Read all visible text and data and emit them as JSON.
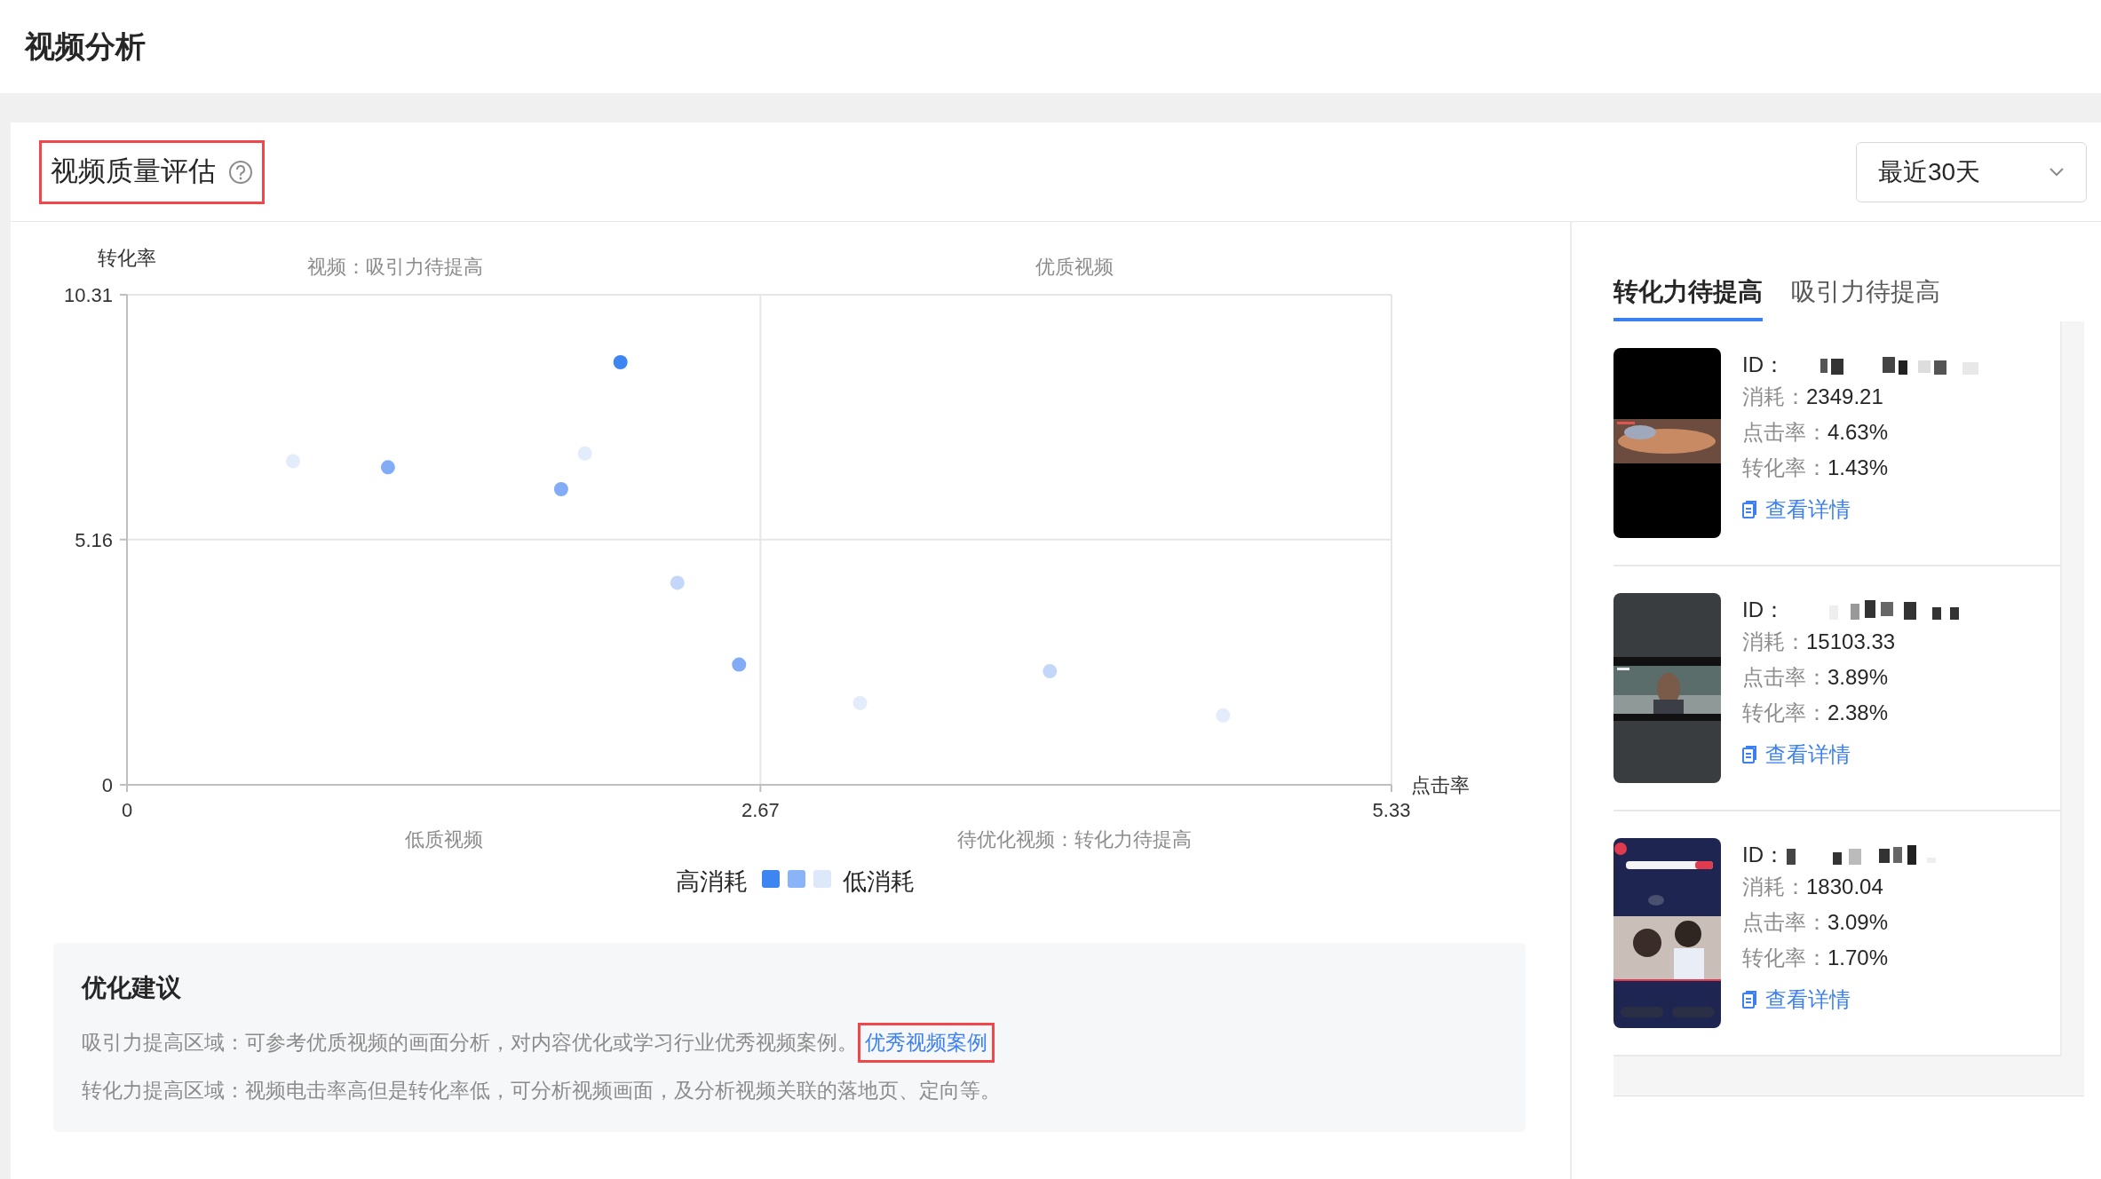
{
  "page_title": "视频分析",
  "card": {
    "title": "视频质量评估",
    "date_range": "最近30天"
  },
  "chart": {
    "quadrant_labels": {
      "top_left": "视频：吸引力待提高",
      "top_right": "优质视频",
      "bottom_left": "低质视频",
      "bottom_right": "待优化视频：转化力待提高"
    },
    "legend": {
      "high_label": "高消耗",
      "low_label": "低消耗",
      "swatches": [
        {
          "color": "#3d85f0"
        },
        {
          "color": "#8ab4f8"
        },
        {
          "color": "#dde8fb"
        }
      ]
    },
    "chart_data": {
      "type": "scatter",
      "xlabel": "点击率",
      "ylabel": "转化率",
      "xlim": [
        0,
        5.33
      ],
      "ylim": [
        0,
        10.31
      ],
      "xticks": [
        0,
        2.67,
        5.33
      ],
      "yticks": [
        0,
        5.16,
        10.31
      ],
      "series": [
        {
          "color": "#3d85f0",
          "x": [
            2.08
          ],
          "values": [
            8.89
          ]
        },
        {
          "color": "#82acf5",
          "x": [
            1.1,
            1.83,
            2.58
          ],
          "values": [
            6.68,
            6.22,
            2.53
          ]
        },
        {
          "color": "#c3d7fa",
          "x": [
            2.32,
            3.89
          ],
          "values": [
            4.25,
            2.39
          ]
        },
        {
          "color": "#e3ecfb",
          "x": [
            0.7,
            1.93,
            3.09,
            4.62
          ],
          "values": [
            6.81,
            6.97,
            1.72,
            1.46
          ]
        }
      ]
    }
  },
  "suggestions": {
    "title": "优化建议",
    "lines": [
      {
        "text": "吸引力提高区域：可参考优质视频的画面分析，对内容优化或学习行业优秀视频案例。",
        "link": "优秀视频案例"
      },
      {
        "text": "转化力提高区域：视频电击率高但是转化率低，可分析视频画面，及分析视频关联的落地页、定向等。"
      }
    ]
  },
  "side_panel": {
    "tabs": [
      {
        "label": "转化力待提高",
        "selected": true
      },
      {
        "label": "吸引力待提高",
        "selected": false
      }
    ],
    "videos": [
      {
        "id_label": "ID：",
        "cost_label": "消耗：",
        "cost": "2349.21",
        "ctr_label": "点击率：",
        "ctr": "4.63%",
        "cvr_label": "转化率：",
        "cvr": "1.43%",
        "link": "查看详情"
      },
      {
        "id_label": "ID：",
        "cost_label": "消耗：",
        "cost": "15103.33",
        "ctr_label": "点击率：",
        "ctr": "3.89%",
        "cvr_label": "转化率：",
        "cvr": "2.38%",
        "link": "查看详情"
      },
      {
        "id_label": "ID：",
        "cost_label": "消耗：",
        "cost": "1830.04",
        "ctr_label": "点击率：",
        "ctr": "3.09%",
        "cvr_label": "转化率：",
        "cvr": "1.70%",
        "link": "查看详情"
      }
    ]
  }
}
